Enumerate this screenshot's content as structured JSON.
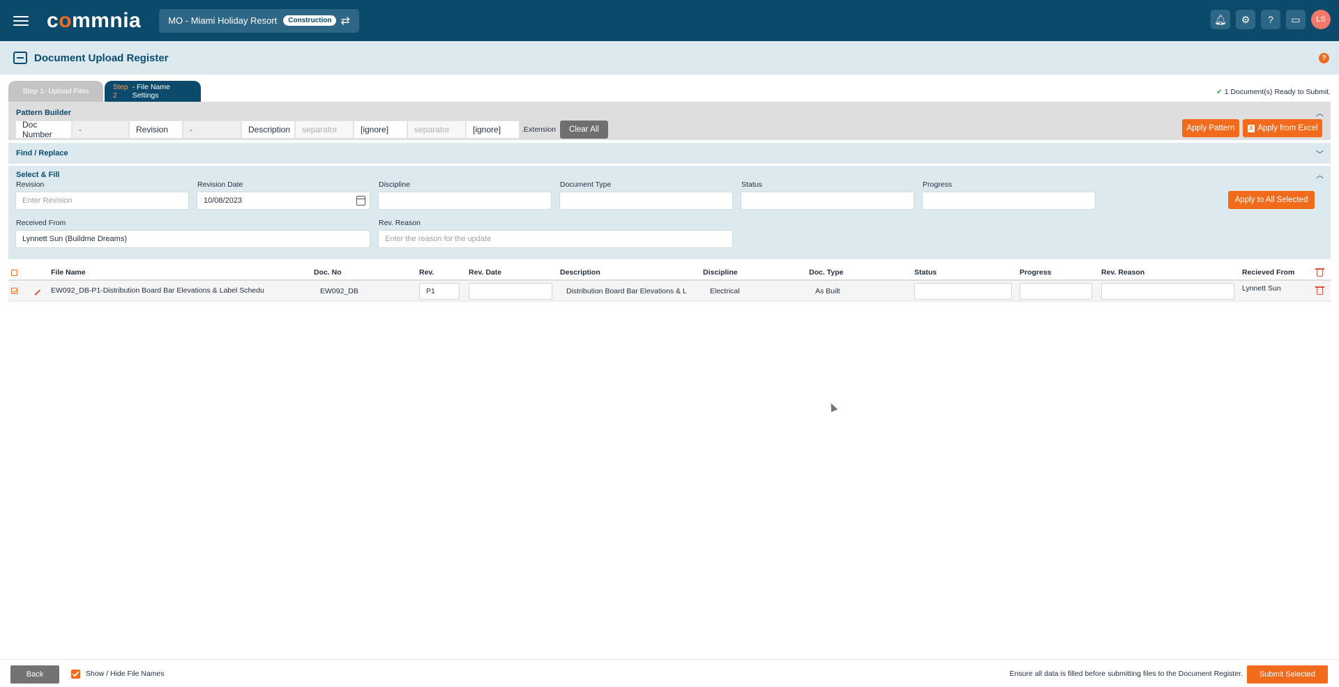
{
  "app": {
    "logo_text_a": "c",
    "logo_text_o": "o",
    "logo_text_b": "mmnia",
    "project_name": "MO - Miami Holiday Resort",
    "project_badge": "Construction",
    "avatar_initials": "LS",
    "accent_color": "#f26b1d",
    "brand_color": "#0b4a6b"
  },
  "page": {
    "title": "Document Upload Register",
    "help": "?"
  },
  "tabs": [
    {
      "step": "Step 1",
      "label": " - Upload Files"
    },
    {
      "step": "Step 2",
      "label": " - File Name Settings"
    }
  ],
  "ready_text": "1 Document(s) Ready to Submit.",
  "pattern_builder": {
    "title": "Pattern Builder",
    "cells": [
      "Doc Number",
      "-",
      "Revision",
      "-",
      "Description",
      "separator",
      "[ignore]",
      "separator",
      "[ignore]"
    ],
    "extension": ".Extension",
    "clear_all": "Clear All",
    "apply_pattern": "Apply Pattern",
    "apply_excel": "Apply from Excel"
  },
  "find_replace": {
    "title": "Find / Replace"
  },
  "select_fill": {
    "title": "Select & Fill",
    "revision_label": "Revision",
    "revision_placeholder": "Enter Revision",
    "revision_date_label": "Revision Date",
    "revision_date_value": "10/08/2023",
    "discipline_label": "Discipline",
    "doc_type_label": "Document Type",
    "status_label": "Status",
    "progress_label": "Progress",
    "apply_all": "Apply to All Selected",
    "received_from_label": "Received From",
    "received_from_value": "Lynnett Sun (Buildme Dreams)",
    "rev_reason_label": "Rev. Reason",
    "rev_reason_placeholder": "Enter the reason for the update"
  },
  "table": {
    "headers": [
      "File Name",
      "Doc. No",
      "Rev.",
      "Rev. Date",
      "Description",
      "Discipline",
      "Doc. Type",
      "Status",
      "Progress",
      "Rev. Reason",
      "Recieved From"
    ],
    "rows": [
      {
        "file_name": "EW092_DB-P1-Distribution Board Bar Elevations & Label Schedu",
        "doc_no": "EW092_DB",
        "rev": "P1",
        "rev_date": "",
        "description": "Distribution Board Bar Elevations & L",
        "discipline": "Electrical",
        "doc_type": "As Built",
        "status": "",
        "progress": "",
        "rev_reason": "",
        "received_from": "Lynnett Sun"
      }
    ]
  },
  "footer": {
    "back": "Back",
    "show_hide": "Show / Hide File Names",
    "ensure": "Ensure all data is filled before submitting files to the Document Register.",
    "submit": "Submit Selected"
  }
}
